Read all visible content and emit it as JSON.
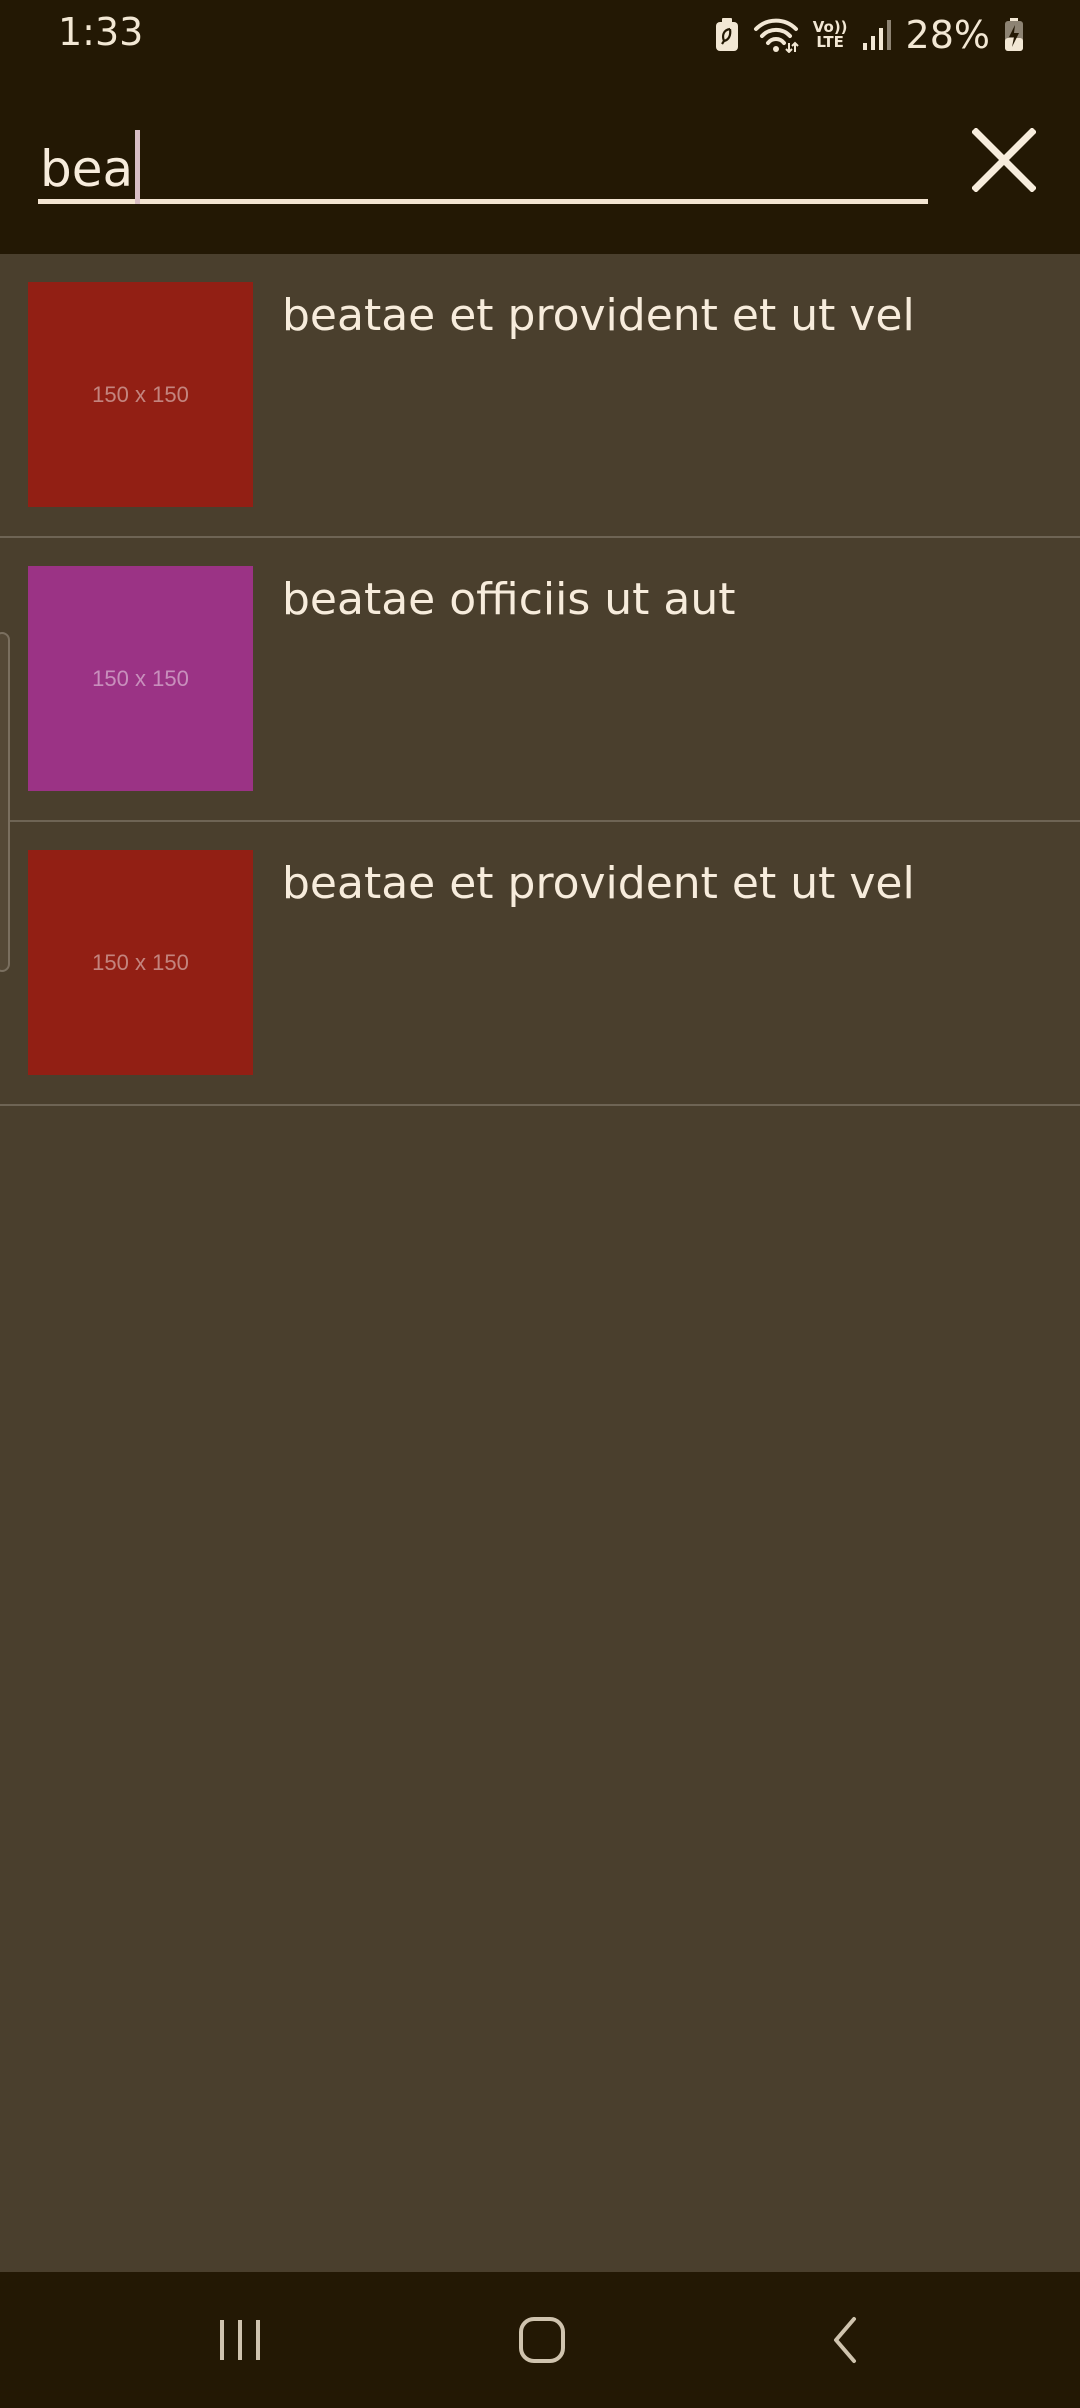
{
  "status_bar": {
    "time": "1:33",
    "lte_top": "Vo))",
    "lte_bottom": "LTE",
    "battery_percent": "28%",
    "icons": [
      "battery-saver-icon",
      "wifi-icon",
      "volte-icon",
      "signal-icon",
      "battery-charging-icon"
    ]
  },
  "search": {
    "value": "bea",
    "close_icon": "close-icon"
  },
  "results": [
    {
      "title": "beatae et provident et ut vel",
      "thumb_label": "150 x 150",
      "thumb_color": "#921f14"
    },
    {
      "title": "beatae officiis ut aut",
      "thumb_label": "150 x 150",
      "thumb_color": "#9b3385"
    },
    {
      "title": "beatae et provident et ut vel",
      "thumb_label": "150 x 150",
      "thumb_color": "#921f14"
    }
  ],
  "nav_bar": {
    "icons": [
      "recents-icon",
      "home-icon",
      "back-icon"
    ]
  },
  "colors": {
    "header_bg": "#231804",
    "content_bg": "#4a3f2d",
    "text": "#f7ecdc",
    "divider": "#6e6454"
  }
}
